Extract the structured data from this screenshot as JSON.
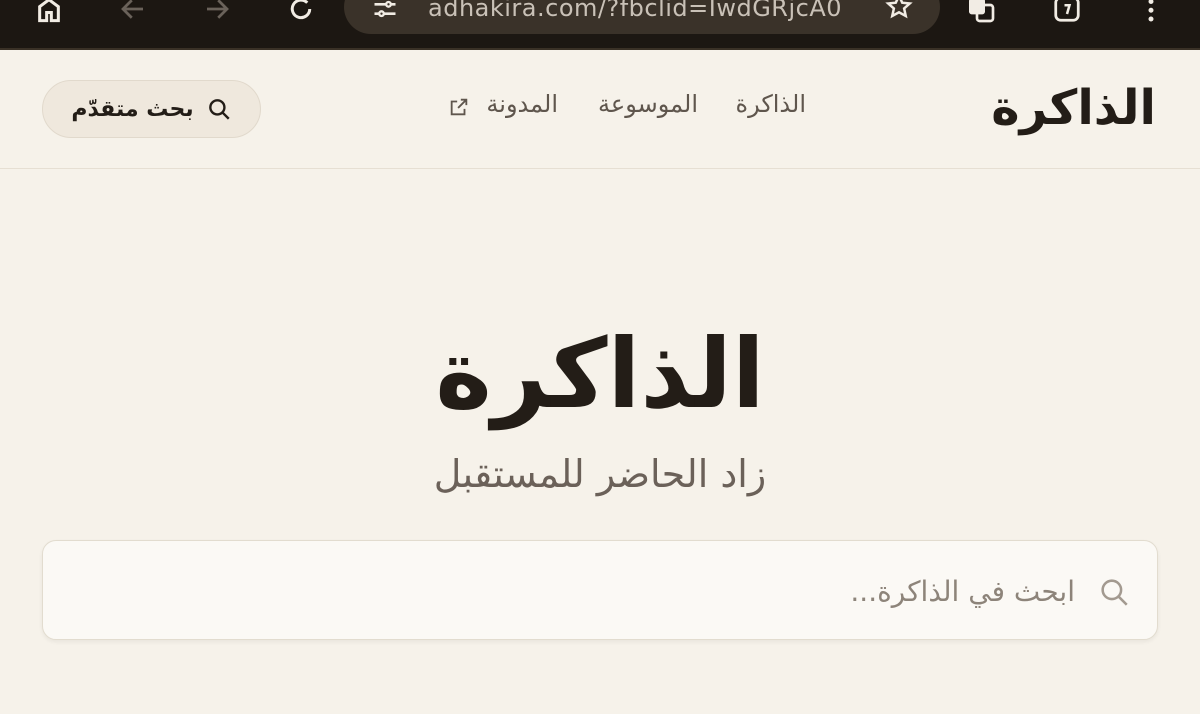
{
  "browser": {
    "url": "adhakira.com/?fbclid=IwdGRjcA0",
    "icons": [
      "home-icon",
      "back-icon",
      "forward-icon",
      "reload-icon",
      "site-settings-icon",
      "bookmark-star-icon",
      "translate-icon",
      "tabs-icon",
      "menu-icon"
    ]
  },
  "header": {
    "logo": "الذاكرة",
    "nav": [
      {
        "label": "الذاكرة"
      },
      {
        "label": "الموسوعة"
      },
      {
        "label": "المدونة"
      }
    ],
    "advanced_search_label": "بحث متقدّم"
  },
  "hero": {
    "title": "الذاكرة",
    "subtitle": "زاد الحاضر للمستقبل"
  },
  "search": {
    "placeholder": "ابحث في الذاكرة..."
  },
  "colors": {
    "page_bg": "#f6f2ea",
    "text_dark": "#231d17",
    "text_muted": "#6b6159",
    "chrome_bg": "#1c1712"
  }
}
